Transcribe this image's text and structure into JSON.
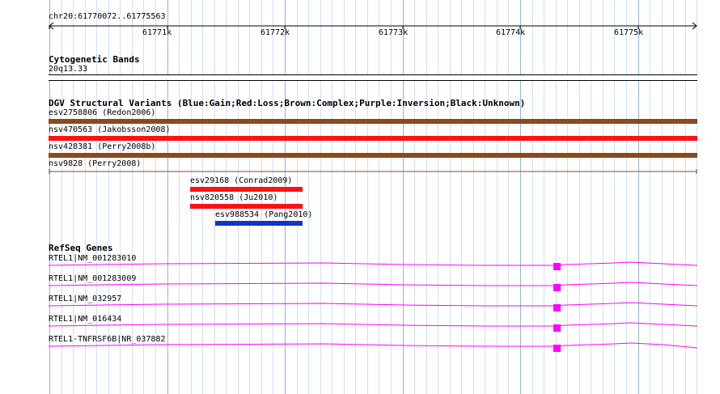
{
  "ruler": {
    "location": "chr20:61770072..61775563",
    "ticks": [
      "61771k",
      "61772k",
      "61773k",
      "61774k",
      "61775k"
    ]
  },
  "cytoband": {
    "title": "Cytogenetic Bands",
    "band": "20q13.33"
  },
  "dgv": {
    "title": "DGV Structural Variants (Blue:Gain;Red:Loss;Brown:Complex;Purple:Inversion;Black:Unknown)",
    "colors": {
      "gain": "#1433cc",
      "loss": "#ff1111",
      "complex": "#8b4a1c",
      "purple": "#800080",
      "unknown": "#000000"
    },
    "features": [
      {
        "label": "esv2758806 (Redon2006)",
        "type": "complex"
      },
      {
        "label": "nsv470563 (Jakobsson2008)",
        "type": "loss"
      },
      {
        "label": "nsv428381 (Perry2008b)",
        "type": "complex"
      },
      {
        "label": "nsv9828 (Perry2008)",
        "type": "complex"
      },
      {
        "label": "esv29168 (Conrad2009)",
        "type": "loss"
      },
      {
        "label": "nsv820558 (Ju2010)",
        "type": "loss"
      },
      {
        "label": "esv988534 (Pang2010)",
        "type": "gain"
      }
    ]
  },
  "refseq": {
    "title": "RefSeq Genes",
    "color": "#ff00ff",
    "genes": [
      {
        "label": "RTEL1|NM_001283010"
      },
      {
        "label": "RTEL1|NM_001283009"
      },
      {
        "label": "RTEL1|NM_032957"
      },
      {
        "label": "RTEL1|NM_016434"
      },
      {
        "label": "RTEL1-TNFRSF6B|NR_037882"
      }
    ]
  }
}
